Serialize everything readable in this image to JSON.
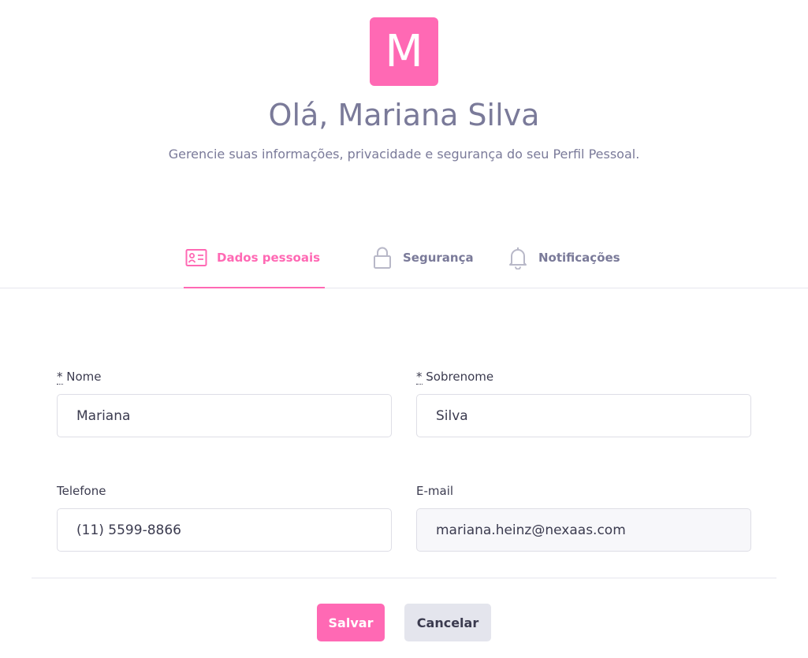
{
  "profile": {
    "avatar_letter": "M",
    "greeting": "Olá, Mariana Silva",
    "subtitle": "Gerencie suas informações, privacidade e segurança do seu Perfil Pessoal."
  },
  "tabs": [
    {
      "label": "Dados pessoais",
      "icon": "id-card-icon",
      "active": true
    },
    {
      "label": "Segurança",
      "icon": "lock-icon",
      "active": false
    },
    {
      "label": "Notificações",
      "icon": "bell-icon",
      "active": false
    }
  ],
  "form": {
    "required_mark": "*",
    "first_name": {
      "label": "Nome",
      "value": "Mariana",
      "required": true
    },
    "last_name": {
      "label": "Sobrenome",
      "value": "Silva",
      "required": true
    },
    "phone": {
      "label": "Telefone",
      "value": "(11) 5599-8866"
    },
    "email": {
      "label": "E-mail",
      "value": "mariana.heinz@nexaas.com",
      "readonly": true
    }
  },
  "actions": {
    "save_label": "Salvar",
    "cancel_label": "Cancelar"
  },
  "colors": {
    "accent": "#ff69b4",
    "muted_text": "#7a7a99",
    "text": "#3b3b4f",
    "secondary_button": "#e4e5ed"
  }
}
